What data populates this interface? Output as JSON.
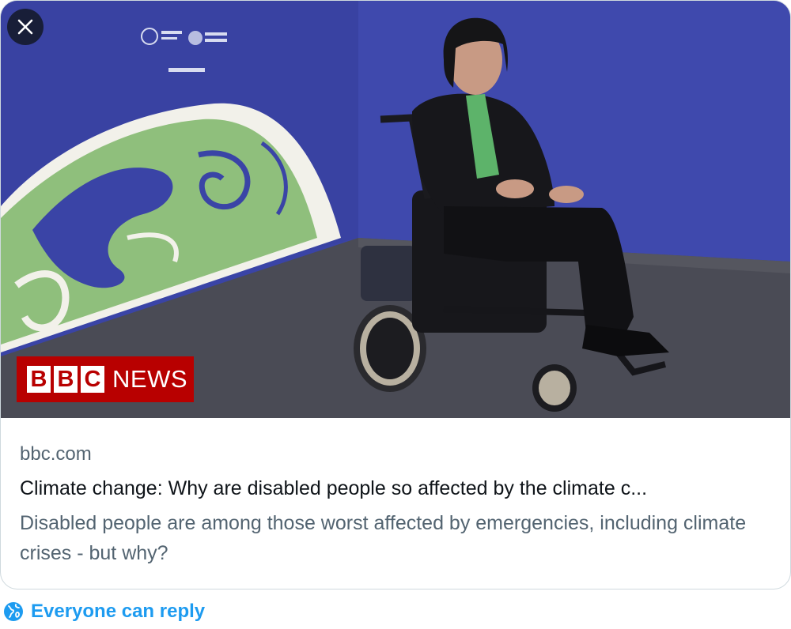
{
  "card": {
    "domain": "bbc.com",
    "headline": "Climate change: Why are disabled people so affected by the climate c...",
    "description": "Disabled people are among those worst affected by emergencies, including climate crises - but why?",
    "image_alt": "Woman in a wheelchair in front of a COP26 backdrop showing a stylised Earth"
  },
  "logo": {
    "letters": [
      "B",
      "B",
      "C"
    ],
    "word": "NEWS",
    "color": "#b80000"
  },
  "controls": {
    "close_icon": "close-icon",
    "reply_icon": "globe-icon",
    "reply_label": "Everyone can reply"
  },
  "colors": {
    "accent": "#1d9bf0",
    "secondary_text": "#536471",
    "primary_text": "#0f1419",
    "backdrop": "#3c44a4"
  }
}
